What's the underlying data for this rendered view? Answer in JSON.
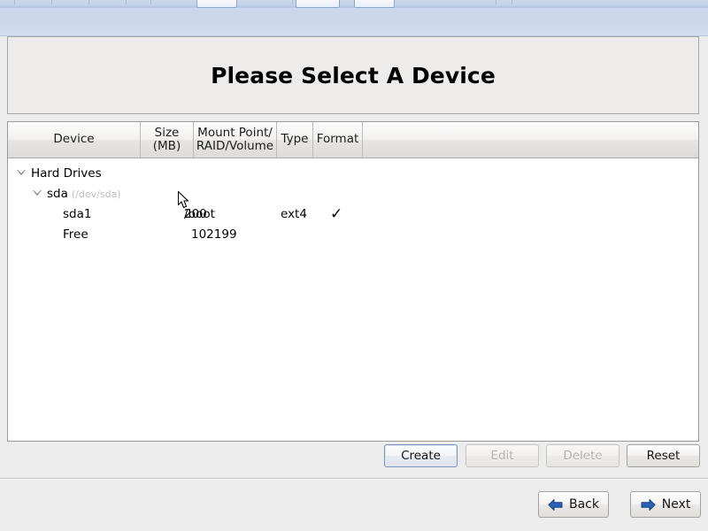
{
  "window": {
    "title": "Please Select A Device"
  },
  "device_table": {
    "columns": [
      {
        "id": "device",
        "label": "Device"
      },
      {
        "id": "size",
        "label": "Size\n(MB)",
        "line1": "Size",
        "line2": "(MB)"
      },
      {
        "id": "mount",
        "label": "Mount Point/\nRAID/Volume",
        "line1": "Mount Point/",
        "line2": "RAID/Volume"
      },
      {
        "id": "type",
        "label": "Type"
      },
      {
        "id": "format",
        "label": "Format"
      },
      {
        "id": "filler",
        "label": ""
      }
    ],
    "rows": [
      {
        "name": "Hard Drives",
        "detail": "",
        "size": "",
        "mount": "",
        "type": "",
        "format": false,
        "indent": 0,
        "expander": "expanded"
      },
      {
        "name": "sda",
        "detail": "(/dev/sda)",
        "size": "",
        "mount": "",
        "type": "",
        "format": false,
        "indent": 1,
        "expander": "expanded"
      },
      {
        "name": "sda1",
        "detail": "",
        "size": "200",
        "mount": "/boot",
        "type": "ext4",
        "format": true,
        "indent": 2,
        "expander": "none"
      },
      {
        "name": "Free",
        "detail": "",
        "size": "102199",
        "mount": "",
        "type": "",
        "format": false,
        "indent": 2,
        "expander": "none"
      }
    ],
    "format_check_glyph": "check-icon"
  },
  "actions": {
    "create_label": "Create",
    "edit_label": "Edit",
    "delete_label": "Delete",
    "reset_label": "Reset"
  },
  "navigation": {
    "back_label": "Back",
    "next_label": "Next",
    "back_icon": "arrow-left-icon",
    "next_icon": "arrow-right-icon"
  },
  "colors": {
    "banner": "#ccd8ec",
    "panel_bg": "#edecea",
    "tree_bg": "#ffffff",
    "arrow_blue": "#2b62b4",
    "focus_border": "#7b93bd",
    "disabled_text": "#b3b1af"
  }
}
